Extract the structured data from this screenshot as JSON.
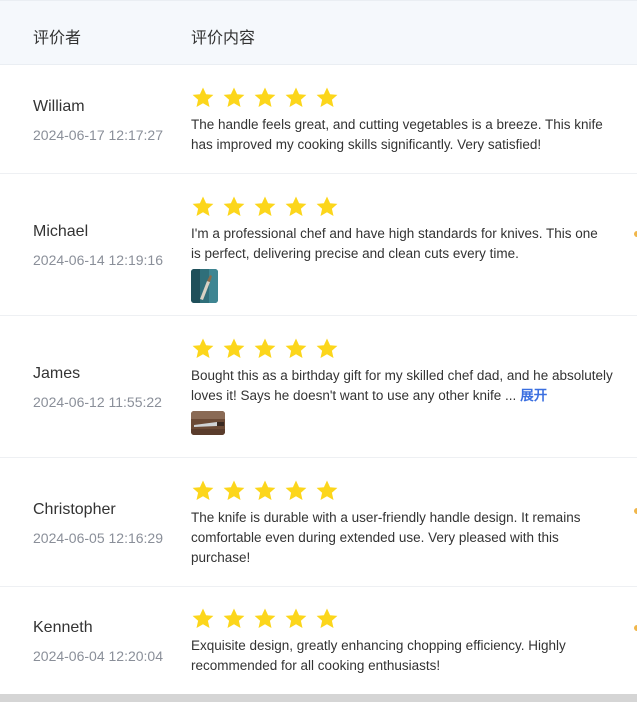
{
  "header": {
    "reviewer_col": "评价者",
    "content_col": "评价内容"
  },
  "colors": {
    "star": "#fcd61b",
    "link": "#3b6fe0",
    "header_bg": "#f5f8fc"
  },
  "reviews": [
    {
      "name": "William",
      "date": "2024-06-17 12:17:27",
      "rating": 5,
      "text": "The handle feels great, and cutting vegetables is a breeze. This knife has improved my cooking skills significantly. Very satisfied!"
    },
    {
      "name": "Michael",
      "date": "2024-06-14 12:19:16",
      "rating": 5,
      "text": "I'm a professional chef and have high standards for knives. This one is perfect, delivering precise and clean cuts every time."
    },
    {
      "name": "James",
      "date": "2024-06-12 11:55:22",
      "rating": 5,
      "text": "Bought this as a birthday gift for my skilled chef dad, and he absolutely loves it! Says he doesn't want to use any other knife ...",
      "more_label": "展开"
    },
    {
      "name": "Christopher",
      "date": "2024-06-05 12:16:29",
      "rating": 5,
      "text": "The knife is durable with a user-friendly handle design. It remains comfortable even during extended use. Very pleased with this purchase!"
    },
    {
      "name": "Kenneth",
      "date": "2024-06-04 12:20:04",
      "rating": 5,
      "text": "Exquisite design, greatly enhancing chopping efficiency. Highly recommended for all cooking enthusiasts!"
    }
  ]
}
